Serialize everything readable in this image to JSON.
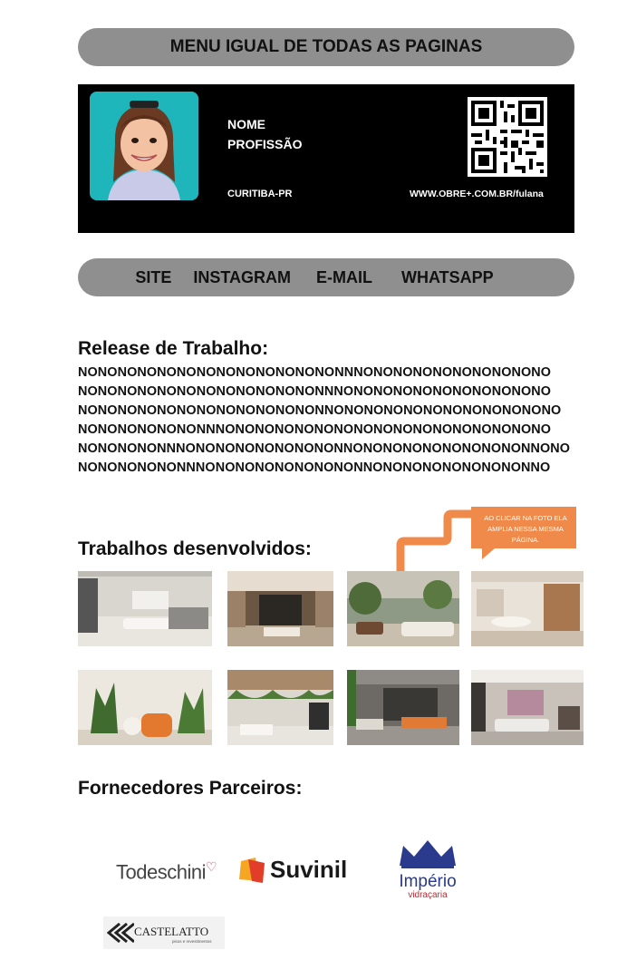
{
  "menu": {
    "title": "MENU IGUAL DE TODAS AS PAGINAS"
  },
  "profile": {
    "name": "NOME",
    "profession": "PROFISSÃO",
    "city": "CURITIBA-PR",
    "url": "WWW.OBRE+.COM.BR/fulana"
  },
  "contacts": {
    "site": "SITE",
    "instagram": "INSTAGRAM",
    "email": "E-MAIL",
    "whatsapp": "WHATSAPP"
  },
  "release": {
    "heading": "Release de Trabalho:",
    "lines": [
      "NONONONONONONONONONONONONONNNONONONONONONONONONO",
      "NONONONONONONONONONONONONNNONONONONONONONONONONO",
      "NONONONONONONONONONONONONNONONONONONONONONONONONO",
      "NONONONONONONNNONONONONONONONONONONONONONONONONO",
      "NONONONONNNONONONONONONONONNONONONONONONONONONNONO",
      "NONONONONONNNONONONONONONONONNONONONONONONONONNO"
    ]
  },
  "works": {
    "heading": "Trabalhos desenvolvidos:",
    "note": [
      "AO CLICAR NA FOTO ELA",
      "AMPLIA NESSA MESMA",
      "PÁGINA."
    ],
    "photos": [
      "living room",
      "modern lounge",
      "lounge with trees",
      "dining area",
      "plants living room",
      "garden ceiling room",
      "gray living room",
      "gray sofa room"
    ]
  },
  "partners": {
    "heading": "Fornecedores Parceiros:",
    "todeschini": "Todeschini",
    "suvinil": "Suvinil",
    "imperio": "Império",
    "imperio_sub": "vidraçaria",
    "castelatto": "CASTELATTO",
    "castelatto_sub": "pisos e revestimentos"
  },
  "colors": {
    "pill": "#8f8f8f",
    "card": "#000000",
    "accent": "#f08a4b"
  }
}
